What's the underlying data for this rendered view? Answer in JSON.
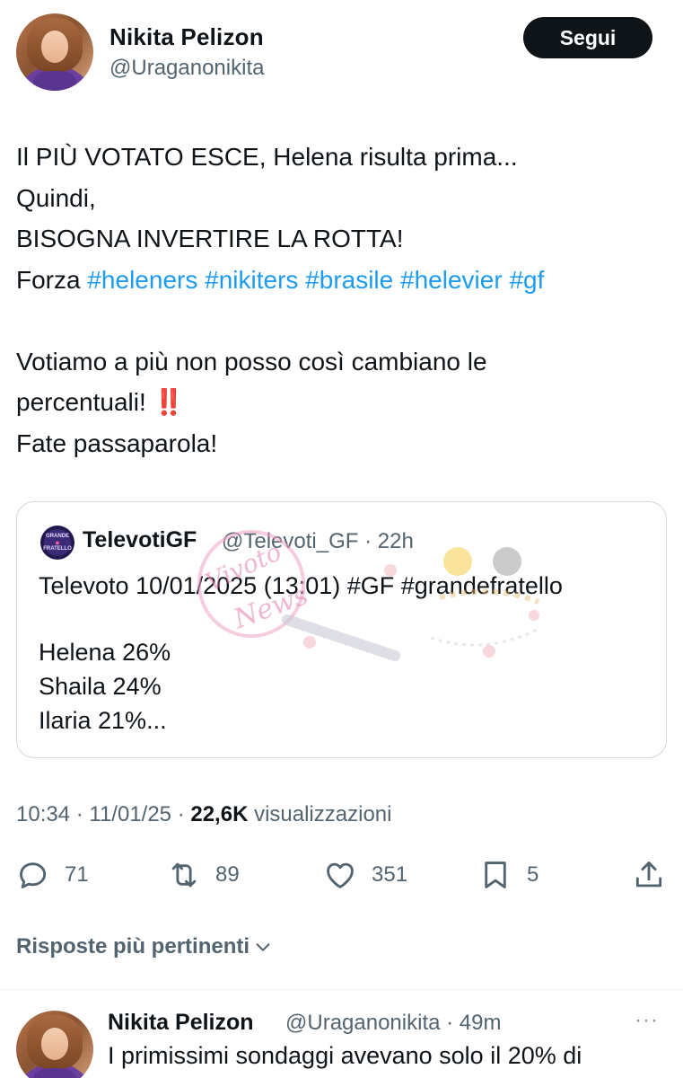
{
  "tweet": {
    "author_name": "Nikita Pelizon",
    "author_handle": "@Uraganonikita",
    "follow_label": "Segui",
    "lines": [
      "Il PIÙ VOTATO ESCE, Helena risulta prima...",
      "Quindi,",
      "BISOGNA INVERTIRE LA ROTTA!"
    ],
    "forza_prefix": "Forza ",
    "hashtags": [
      "#heleners",
      "#nikiters",
      "#brasile",
      "#helevier",
      "#gf"
    ],
    "lines2": [
      "Votiamo a più non posso così cambiano le",
      "percentuali!",
      "Fate passaparola!"
    ],
    "emoji": "‼️"
  },
  "quote": {
    "avatar_text_top": "GRANDE",
    "avatar_text_bottom": "FRATELLO",
    "name": "TelevotiGF",
    "meta": "@Televoti_GF · 22h",
    "text": "Televoto 10/01/2025 (13:01) #GF #grandefratello",
    "poll": [
      "Helena 26%",
      "Shaila 24%",
      "Ilaria 21%..."
    ]
  },
  "watermark": {
    "text": "Vivoto",
    "sub": "News"
  },
  "meta": {
    "time_date": "10:34 · 11/01/25 · ",
    "views": "22,6K",
    "views_label": " visualizzazioni"
  },
  "actions": {
    "replies": "71",
    "retweets": "89",
    "likes": "351",
    "bookmarks": "5"
  },
  "replies_section": {
    "label": "Risposte più pertinenti"
  },
  "reply": {
    "author_name": "Nikita Pelizon",
    "meta": "@Uraganonikita · 49m",
    "more": "···",
    "text": "I primissimi sondaggi avevano solo il 20%  di"
  },
  "colors": {
    "link": "#1d9bf0",
    "text": "#0f1419",
    "secondary": "#536471",
    "border": "#cfd9de"
  }
}
